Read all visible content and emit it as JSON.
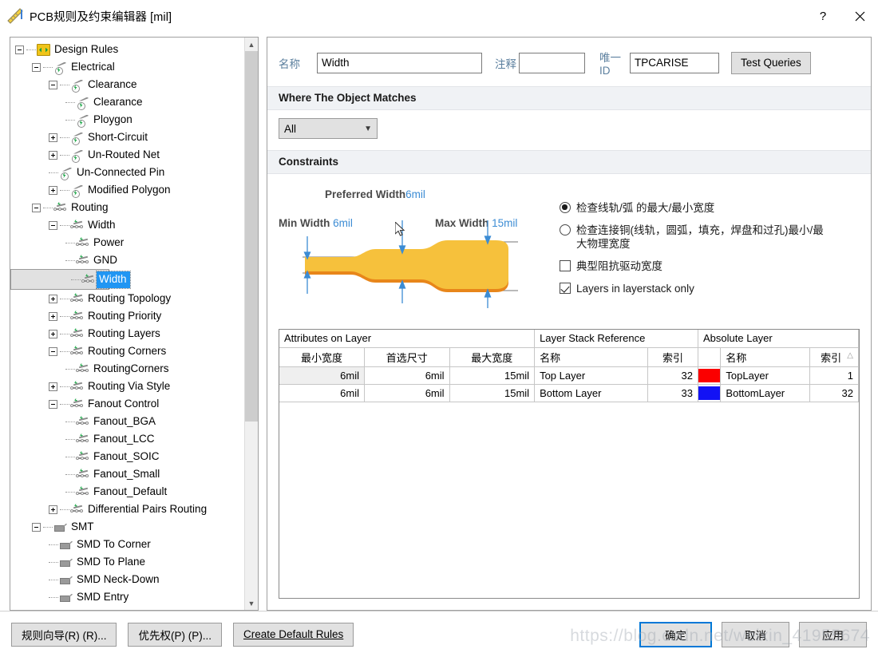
{
  "window": {
    "title": "PCB规则及约束编辑器",
    "unit": "[mil]",
    "icon": "ruler-icon",
    "help_label": "?",
    "close_label": "✕"
  },
  "tree": {
    "items": [
      {
        "label": "Design Rules",
        "depth": 0,
        "expander": "minus",
        "icon": "rules",
        "selected": false
      },
      {
        "label": "Electrical",
        "depth": 1,
        "expander": "minus",
        "icon": "elec",
        "selected": false
      },
      {
        "label": "Clearance",
        "depth": 2,
        "expander": "minus",
        "icon": "elec",
        "selected": false
      },
      {
        "label": "Clearance",
        "depth": 3,
        "expander": "none",
        "icon": "elec",
        "selected": false
      },
      {
        "label": "Ploygon",
        "depth": 3,
        "expander": "none",
        "icon": "elec",
        "selected": false
      },
      {
        "label": "Short-Circuit",
        "depth": 2,
        "expander": "plus",
        "icon": "elec",
        "selected": false
      },
      {
        "label": "Un-Routed Net",
        "depth": 2,
        "expander": "plus",
        "icon": "elec",
        "selected": false
      },
      {
        "label": "Un-Connected Pin",
        "depth": 2,
        "expander": "none",
        "icon": "elec",
        "selected": false
      },
      {
        "label": "Modified Polygon",
        "depth": 2,
        "expander": "plus",
        "icon": "elec",
        "selected": false
      },
      {
        "label": "Routing",
        "depth": 1,
        "expander": "minus",
        "icon": "route",
        "selected": false
      },
      {
        "label": "Width",
        "depth": 2,
        "expander": "minus",
        "icon": "route",
        "selected": false
      },
      {
        "label": "Power",
        "depth": 3,
        "expander": "none",
        "icon": "route",
        "selected": false
      },
      {
        "label": "GND",
        "depth": 3,
        "expander": "none",
        "icon": "route",
        "selected": false
      },
      {
        "label": "Width",
        "depth": 3,
        "expander": "none",
        "icon": "route",
        "selected": true
      },
      {
        "label": "Routing Topology",
        "depth": 2,
        "expander": "plus",
        "icon": "route",
        "selected": false
      },
      {
        "label": "Routing Priority",
        "depth": 2,
        "expander": "plus",
        "icon": "route",
        "selected": false
      },
      {
        "label": "Routing Layers",
        "depth": 2,
        "expander": "plus",
        "icon": "route",
        "selected": false
      },
      {
        "label": "Routing Corners",
        "depth": 2,
        "expander": "minus",
        "icon": "route",
        "selected": false
      },
      {
        "label": "RoutingCorners",
        "depth": 3,
        "expander": "none",
        "icon": "route",
        "selected": false
      },
      {
        "label": "Routing Via Style",
        "depth": 2,
        "expander": "plus",
        "icon": "route",
        "selected": false
      },
      {
        "label": "Fanout Control",
        "depth": 2,
        "expander": "minus",
        "icon": "route",
        "selected": false
      },
      {
        "label": "Fanout_BGA",
        "depth": 3,
        "expander": "none",
        "icon": "route",
        "selected": false
      },
      {
        "label": "Fanout_LCC",
        "depth": 3,
        "expander": "none",
        "icon": "route",
        "selected": false
      },
      {
        "label": "Fanout_SOIC",
        "depth": 3,
        "expander": "none",
        "icon": "route",
        "selected": false
      },
      {
        "label": "Fanout_Small",
        "depth": 3,
        "expander": "none",
        "icon": "route",
        "selected": false
      },
      {
        "label": "Fanout_Default",
        "depth": 3,
        "expander": "none",
        "icon": "route",
        "selected": false
      },
      {
        "label": "Differential Pairs Routing",
        "depth": 2,
        "expander": "plus",
        "icon": "route",
        "selected": false
      },
      {
        "label": "SMT",
        "depth": 1,
        "expander": "minus",
        "icon": "smt",
        "selected": false
      },
      {
        "label": "SMD To Corner",
        "depth": 2,
        "expander": "none",
        "icon": "smt",
        "selected": false
      },
      {
        "label": "SMD To Plane",
        "depth": 2,
        "expander": "none",
        "icon": "smt",
        "selected": false
      },
      {
        "label": "SMD Neck-Down",
        "depth": 2,
        "expander": "none",
        "icon": "smt",
        "selected": false
      },
      {
        "label": "SMD Entry",
        "depth": 2,
        "expander": "none",
        "icon": "smt",
        "selected": false
      }
    ]
  },
  "form": {
    "name_label": "名称",
    "name_value": "Width",
    "comment_label": "注释",
    "comment_value": "",
    "uid_label": "唯一ID",
    "uid_value": "TPCARISE",
    "test_queries_label": "Test Queries"
  },
  "where": {
    "header": "Where The Object Matches",
    "scope_value": "All",
    "chevron": "chevron-down-icon"
  },
  "constraints": {
    "header": "Constraints",
    "diagram": {
      "preferred_label": "Preferred Width",
      "preferred_value": "6mil",
      "min_label": "Min Width",
      "min_value": "6mil",
      "max_label": "Max Width",
      "max_value": "15mil",
      "trace_color": "#f6c13c",
      "trace_shadow": "#e8861a",
      "dim_color": "#3c8cd4"
    },
    "options": [
      {
        "type": "radio",
        "checked": true,
        "label": "检查线轨/弧 的最大/最小宽度"
      },
      {
        "type": "radio",
        "checked": false,
        "label": "检查连接铜(线轨，圆弧，填充，焊盘和过孔)最小/最大物理宽度"
      },
      {
        "type": "checkbox",
        "checked": false,
        "label": "典型阻抗驱动宽度"
      },
      {
        "type": "checkbox",
        "checked": true,
        "label": "Layers in layerstack only"
      }
    ]
  },
  "table": {
    "groups": [
      {
        "label": "Attributes on Layer",
        "span": 3
      },
      {
        "label": "Layer Stack Reference",
        "span": 2
      },
      {
        "label": "Absolute Layer",
        "span": 3
      }
    ],
    "columns": [
      {
        "label": "最小宽度",
        "align": "num"
      },
      {
        "label": "首选尺寸",
        "align": "num"
      },
      {
        "label": "最大宽度",
        "align": "num"
      },
      {
        "label": "名称",
        "align": "txt"
      },
      {
        "label": "索引",
        "align": "num"
      },
      {
        "label": "",
        "align": "txt"
      },
      {
        "label": "名称",
        "align": "txt"
      },
      {
        "label": "索引",
        "align": "num",
        "sort": "asc"
      }
    ],
    "rows": [
      {
        "min": "6mil",
        "preferred": "6mil",
        "max": "15mil",
        "stack_name": "Top Layer",
        "stack_index": "32",
        "color": "#fb0000",
        "abs_name": "TopLayer",
        "abs_index": "1"
      },
      {
        "min": "6mil",
        "preferred": "6mil",
        "max": "15mil",
        "stack_name": "Bottom Layer",
        "stack_index": "33",
        "color": "#1212f5",
        "abs_name": "BottomLayer",
        "abs_index": "32"
      }
    ]
  },
  "footer": {
    "rule_wizard": "规则向导(R) (R)...",
    "priority": "优先权(P) (P)...",
    "create_default": "Create Default Rules",
    "ok": "确定",
    "cancel": "取消",
    "apply": "应用",
    "watermark": "https://blog.csdn.net/weixin_41955674"
  }
}
